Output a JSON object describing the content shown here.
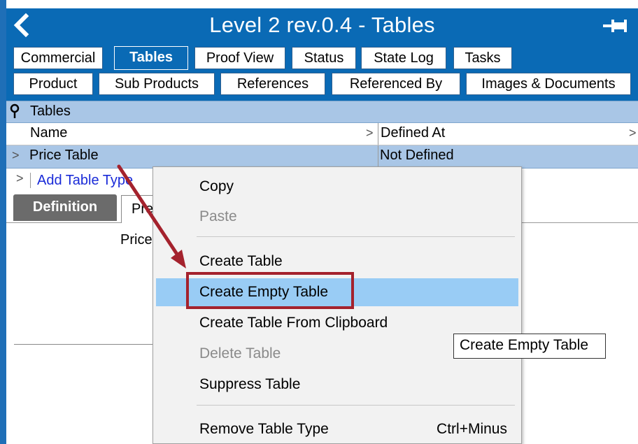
{
  "window": {
    "title": "Level 2 rev.0.4 - Tables",
    "back_icon": "chevron-left-icon",
    "pin_icon": "pin-icon"
  },
  "tabs_row1": [
    {
      "label": "Commercial",
      "active": false
    },
    {
      "label": "Tables",
      "active": true
    },
    {
      "label": "Proof View",
      "active": false
    },
    {
      "label": "Status",
      "active": false
    },
    {
      "label": "State Log",
      "active": false
    },
    {
      "label": "Tasks",
      "active": false
    }
  ],
  "tabs_row2": [
    {
      "label": "Product"
    },
    {
      "label": "Sub Products"
    },
    {
      "label": "References"
    },
    {
      "label": "Referenced By"
    },
    {
      "label": "Images & Documents"
    }
  ],
  "tables_panel": {
    "header": "Tables",
    "columns": {
      "name": "Name",
      "defined_at": "Defined At"
    },
    "rows": [
      {
        "name": "Price Table",
        "defined_at": "Not Defined"
      }
    ],
    "add_link": "Add Table Type"
  },
  "subtabs": {
    "definition": "Definition",
    "preview": "Pre"
  },
  "body": {
    "text": "Price"
  },
  "context_menu": {
    "items": [
      {
        "label": "Copy",
        "enabled": true
      },
      {
        "label": "Paste",
        "enabled": false
      },
      {
        "label": "Create Table",
        "enabled": true
      },
      {
        "label": "Create Empty Table",
        "enabled": true,
        "hovered": true
      },
      {
        "label": "Create Table From Clipboard",
        "enabled": true
      },
      {
        "label": "Delete Table",
        "enabled": false
      },
      {
        "label": "Suppress Table",
        "enabled": true
      },
      {
        "label": "Remove Table Type",
        "enabled": true,
        "shortcut": "Ctrl+Minus"
      }
    ]
  },
  "tooltip": "Create Empty Table",
  "colors": {
    "title_bar": "#0a6ab5",
    "selection": "#a9c6e6",
    "menu_hover": "#99ccf5",
    "annotation": "#a4222d",
    "link": "#1a2bd8"
  }
}
